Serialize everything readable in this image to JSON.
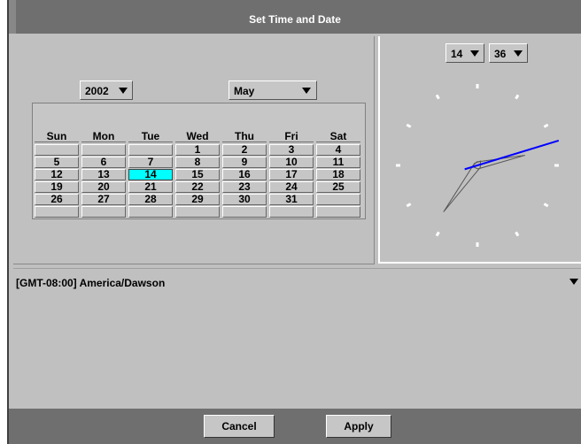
{
  "window": {
    "title": "Set Time and Date"
  },
  "calendar": {
    "year": "2002",
    "month": "May",
    "weekdays": [
      "Sun",
      "Mon",
      "Tue",
      "Wed",
      "Thu",
      "Fri",
      "Sat"
    ],
    "weeks": [
      [
        "",
        "",
        "",
        "1",
        "2",
        "3",
        "4"
      ],
      [
        "5",
        "6",
        "7",
        "8",
        "9",
        "10",
        "11"
      ],
      [
        "12",
        "13",
        "14",
        "15",
        "16",
        "17",
        "18"
      ],
      [
        "19",
        "20",
        "21",
        "22",
        "23",
        "24",
        "25"
      ],
      [
        "26",
        "27",
        "28",
        "29",
        "30",
        "31",
        ""
      ],
      [
        "",
        "",
        "",
        "",
        "",
        "",
        ""
      ]
    ],
    "selected_day": "14",
    "selected_color": "#00ffff"
  },
  "clock": {
    "hour": "14",
    "minute": "36",
    "second_hand_color": "#0000ff"
  },
  "timezone": {
    "value": "[GMT-08:00]  America/Dawson"
  },
  "buttons": {
    "cancel": "Cancel",
    "apply": "Apply"
  }
}
